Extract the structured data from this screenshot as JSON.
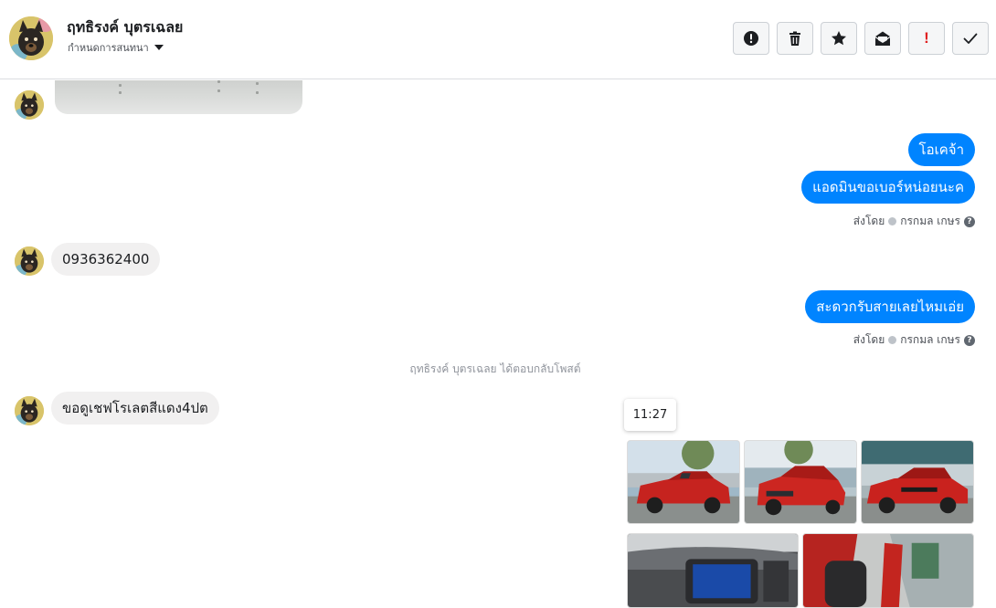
{
  "header": {
    "contact_name": "ฤทธิรงค์ บุตรเฉลย",
    "assign_label": "กำหนดการสนทนา",
    "actions": [
      {
        "name": "report-spam-button",
        "icon": "alert-circle-icon"
      },
      {
        "name": "delete-button",
        "icon": "trash-icon"
      },
      {
        "name": "star-button",
        "icon": "star-icon"
      },
      {
        "name": "mark-unread-button",
        "icon": "envelope-open-icon"
      },
      {
        "name": "mark-important-button",
        "icon": "exclamation-icon",
        "glyph": "!"
      },
      {
        "name": "mark-done-button",
        "icon": "check-icon"
      }
    ]
  },
  "messages": {
    "out_1": "โอเคจ้า",
    "out_2": "แอดมินขอเบอร์หน่อยนะค",
    "in_phone": "0936362400",
    "out_3": "สะดวกรับสายเลยไหมเอ่ย",
    "in_request": "ขอดูเชฟโรเลตสีแดง4ปต"
  },
  "sent_by": {
    "prefix": "ส่งโดย",
    "agent": "กรกมล เกษร",
    "help": "?"
  },
  "system_note": "ฤทธิรงค์ บุตรเฉลย ได้ตอบกลับโพสต์",
  "tooltip_time": "11:27",
  "colors": {
    "outgoing_bubble": "#0084ff",
    "incoming_bubble": "#f1f0f0",
    "danger": "#e02020",
    "divider": "#dadde1"
  }
}
